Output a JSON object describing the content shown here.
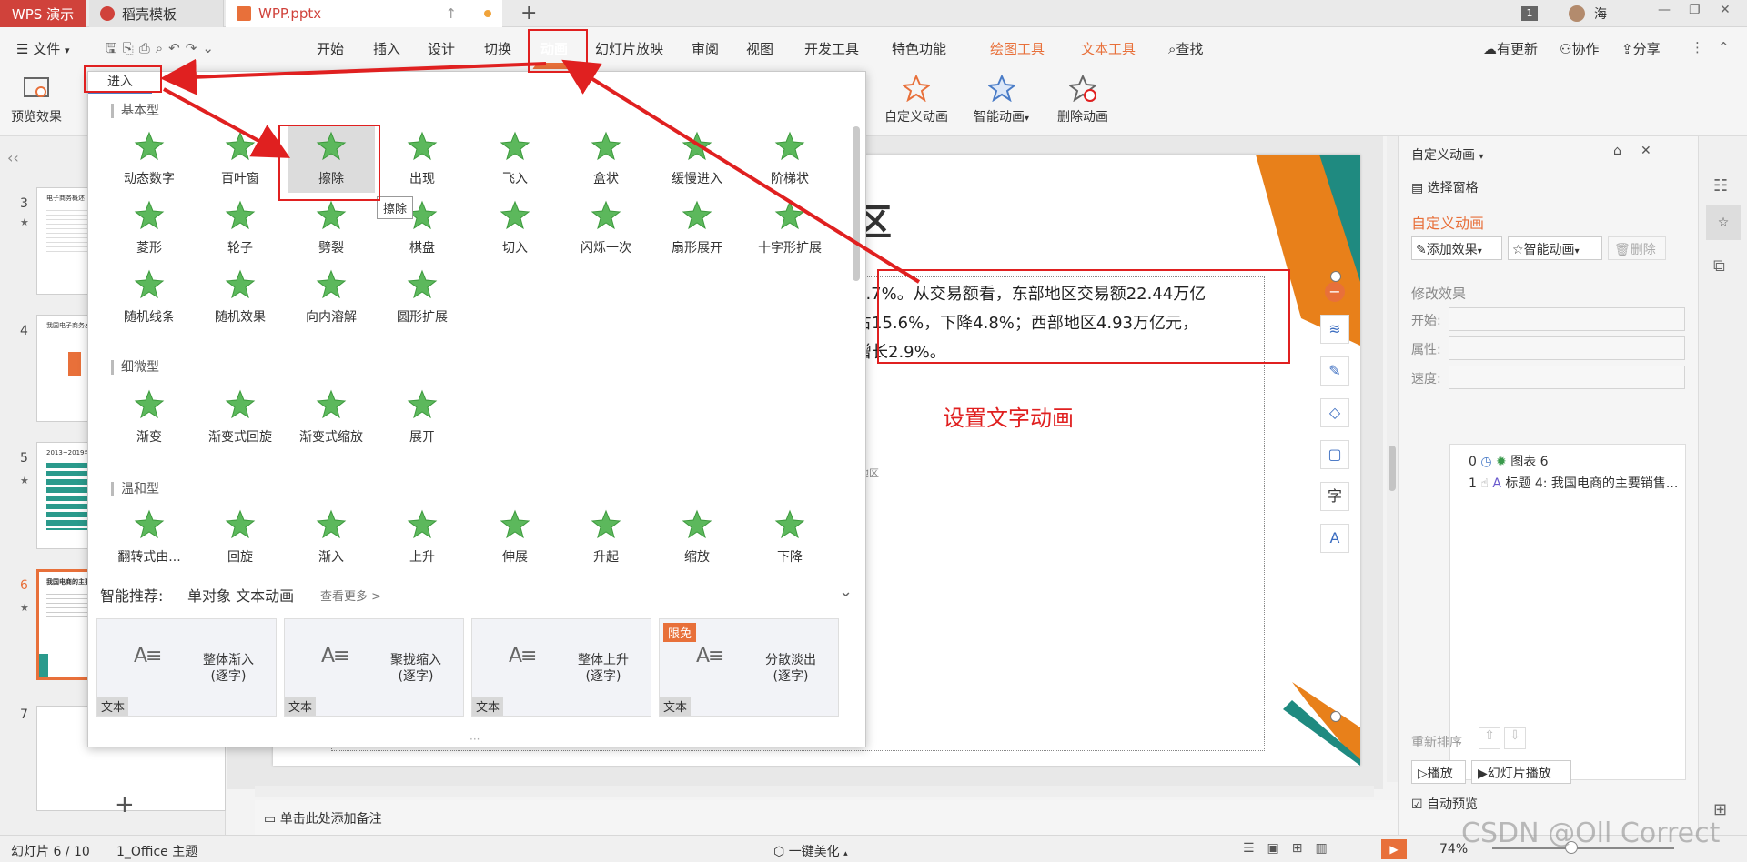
{
  "titlebar": {
    "wps_tab": "WPS 演示",
    "daoke_tab": "稻壳模板",
    "file_tab": "WPP.pptx",
    "new_tab": "+",
    "badge": "1",
    "user": "海"
  },
  "menu": {
    "file": "文件",
    "items": [
      "开始",
      "插入",
      "设计",
      "切换",
      "动画",
      "幻灯片放映",
      "审阅",
      "视图",
      "开发工具",
      "特色功能"
    ],
    "context_items": [
      "绘图工具",
      "文本工具"
    ],
    "search": "查找",
    "right": [
      "有更新",
      "协作",
      "分享"
    ]
  },
  "ribbon": {
    "preview": "预览效果",
    "custom_animation": "自定义动画",
    "smart_animation": "智能动画",
    "delete_animation": "删除动画"
  },
  "dropdown": {
    "tab": "进入",
    "sections": {
      "basic": "基本型",
      "subtle": "细微型",
      "moderate": "温和型"
    },
    "basic_effects": [
      "动态数字",
      "百叶窗",
      "擦除",
      "出现",
      "飞入",
      "盒状",
      "缓慢进入",
      "阶梯状",
      "菱形",
      "轮子",
      "劈裂",
      "棋盘",
      "切入",
      "闪烁一次",
      "扇形展开",
      "十字形扩展",
      "随机线条",
      "随机效果",
      "向内溶解",
      "圆形扩展"
    ],
    "subtle_effects": [
      "渐变",
      "渐变式回旋",
      "渐变式缩放",
      "展开"
    ],
    "moderate_effects": [
      "翻转式由...",
      "回旋",
      "渐入",
      "上升",
      "伸展",
      "升起",
      "缩放",
      "下降"
    ],
    "tooltip": "擦除",
    "smart_label": "智能推荐:",
    "smart_desc": "单对象 文本动画",
    "see_more": "查看更多 >",
    "recommend": [
      {
        "title": "整体渐入",
        "sub": "(逐字)",
        "tag": "文本",
        "badge": ""
      },
      {
        "title": "聚拢缩入",
        "sub": "(逐字)",
        "tag": "文本",
        "badge": ""
      },
      {
        "title": "整体上升",
        "sub": "(逐字)",
        "tag": "文本",
        "badge": ""
      },
      {
        "title": "分散淡出",
        "sub": "(逐字)",
        "tag": "文本",
        "badge": "限免"
      }
    ]
  },
  "left_panel": {
    "slides": [
      "3",
      "4",
      "5",
      "6",
      "7"
    ],
    "thumb_titles": {
      "s3": "电子商务概述",
      "s4": "我国电子商务发展",
      "s5": "2013~2019年中国网络零售",
      "s6": "我国电商的主要销售"
    },
    "add": "+"
  },
  "slide": {
    "heading_fragment": "区",
    "line1": "6.7%。从交易额看，东部地区交易额22.44万亿",
    "line2": "占15.6%，下降4.8%；西部地区4.93万亿元，",
    "line3": "增长2.9%。",
    "annotation": "设置文字动画",
    "small_label": "地区"
  },
  "notes": {
    "placeholder": "单击此处添加备注"
  },
  "right_panel": {
    "title": "自定义动画",
    "select_pane": "选择窗格",
    "custom_anim_heading": "自定义动画",
    "add_effect": "添加效果",
    "smart_anim": "智能动画",
    "delete": "删除",
    "modify_effect": "修改效果",
    "start_label": "开始:",
    "property_label": "属性:",
    "speed_label": "速度:",
    "list": [
      {
        "index": "0",
        "name": "图表 6"
      },
      {
        "index": "1",
        "name": "标题 4: 我国电商的主要销售..."
      }
    ],
    "reorder": "重新排序",
    "play": "播放",
    "slideshow": "幻灯片播放",
    "auto_preview": "自动预览"
  },
  "status": {
    "slide_info": "幻灯片 6 / 10",
    "theme": "1_Office 主题",
    "beautify": "一键美化",
    "zoom": "74%",
    "watermark": "CSDN @Oll Correct"
  },
  "colors": {
    "accent": "#e8703a",
    "wps_red": "#d0423b",
    "annotation_red": "#e02020",
    "star_green": "#5cb85c"
  }
}
